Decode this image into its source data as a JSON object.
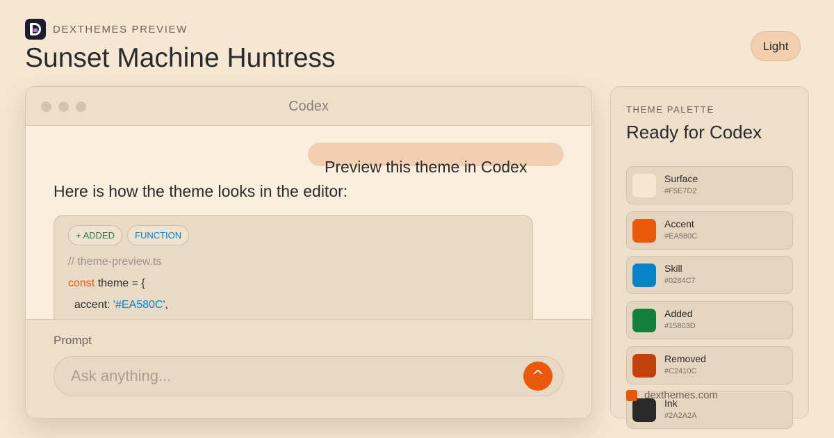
{
  "header": {
    "brand_label": "DEXTHEMES PREVIEW",
    "title": "Sunset Machine Huntress",
    "mode_button": "Light"
  },
  "window": {
    "title": "Codex",
    "user_message": "Preview this theme in Codex",
    "assistant_message": "Here is how the theme looks in the editor:",
    "code_card": {
      "chips": [
        "+ ADDED",
        "FUNCTION"
      ],
      "comment": "// theme-preview.ts",
      "line2": {
        "keyword": "const",
        "rest": " theme = {"
      },
      "line3": {
        "key": "  accent: ",
        "value": "'#EA580C'",
        "tail": ","
      }
    },
    "prompt": {
      "label": "Prompt",
      "placeholder": "Ask anything...",
      "send_symbol": "^"
    }
  },
  "palette": {
    "label": "THEME PALETTE",
    "title": "Ready for Codex",
    "swatches": [
      {
        "name": "Surface",
        "hex": "#F5E7D2",
        "color": "#F5E7D2"
      },
      {
        "name": "Accent",
        "hex": "#EA580C",
        "color": "#EA580C"
      },
      {
        "name": "Skill",
        "hex": "#0284C7",
        "color": "#0284C7"
      },
      {
        "name": "Added",
        "hex": "#15803D",
        "color": "#15803D"
      },
      {
        "name": "Removed",
        "hex": "#C2410C",
        "color": "#C2410C"
      },
      {
        "name": "Ink",
        "hex": "#2A2A2A",
        "color": "#2A2A2A"
      }
    ]
  },
  "footer": {
    "site": "dexthemes.com"
  },
  "colors": {
    "background": "#F5E7D2",
    "accent": "#EA580C",
    "skill": "#0284C7",
    "added": "#15803D",
    "ink": "#2A2A2A"
  }
}
